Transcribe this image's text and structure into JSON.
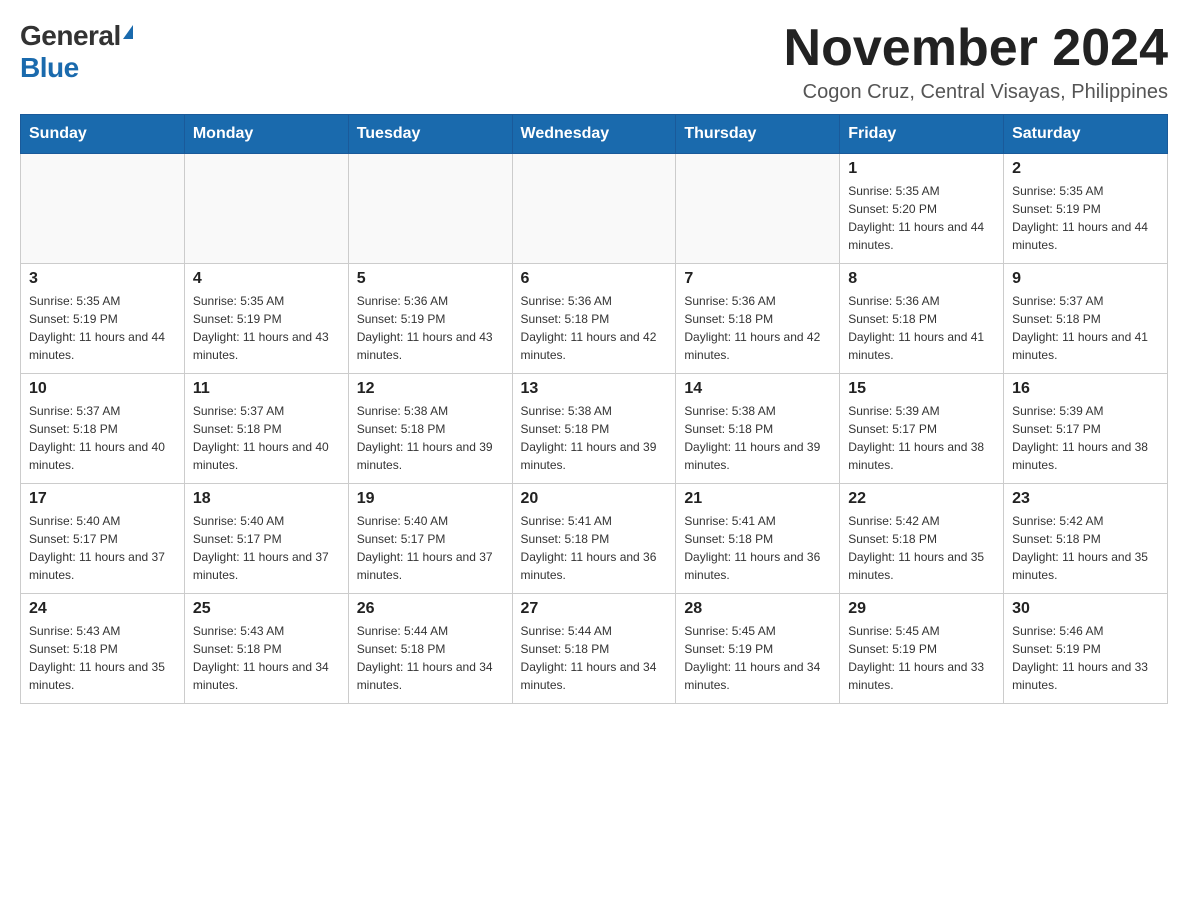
{
  "header": {
    "logo_general": "General",
    "logo_blue": "Blue",
    "month_title": "November 2024",
    "location": "Cogon Cruz, Central Visayas, Philippines"
  },
  "weekdays": [
    "Sunday",
    "Monday",
    "Tuesday",
    "Wednesday",
    "Thursday",
    "Friday",
    "Saturday"
  ],
  "weeks": [
    [
      {
        "day": "",
        "sunrise": "",
        "sunset": "",
        "daylight": ""
      },
      {
        "day": "",
        "sunrise": "",
        "sunset": "",
        "daylight": ""
      },
      {
        "day": "",
        "sunrise": "",
        "sunset": "",
        "daylight": ""
      },
      {
        "day": "",
        "sunrise": "",
        "sunset": "",
        "daylight": ""
      },
      {
        "day": "",
        "sunrise": "",
        "sunset": "",
        "daylight": ""
      },
      {
        "day": "1",
        "sunrise": "Sunrise: 5:35 AM",
        "sunset": "Sunset: 5:20 PM",
        "daylight": "Daylight: 11 hours and 44 minutes."
      },
      {
        "day": "2",
        "sunrise": "Sunrise: 5:35 AM",
        "sunset": "Sunset: 5:19 PM",
        "daylight": "Daylight: 11 hours and 44 minutes."
      }
    ],
    [
      {
        "day": "3",
        "sunrise": "Sunrise: 5:35 AM",
        "sunset": "Sunset: 5:19 PM",
        "daylight": "Daylight: 11 hours and 44 minutes."
      },
      {
        "day": "4",
        "sunrise": "Sunrise: 5:35 AM",
        "sunset": "Sunset: 5:19 PM",
        "daylight": "Daylight: 11 hours and 43 minutes."
      },
      {
        "day": "5",
        "sunrise": "Sunrise: 5:36 AM",
        "sunset": "Sunset: 5:19 PM",
        "daylight": "Daylight: 11 hours and 43 minutes."
      },
      {
        "day": "6",
        "sunrise": "Sunrise: 5:36 AM",
        "sunset": "Sunset: 5:18 PM",
        "daylight": "Daylight: 11 hours and 42 minutes."
      },
      {
        "day": "7",
        "sunrise": "Sunrise: 5:36 AM",
        "sunset": "Sunset: 5:18 PM",
        "daylight": "Daylight: 11 hours and 42 minutes."
      },
      {
        "day": "8",
        "sunrise": "Sunrise: 5:36 AM",
        "sunset": "Sunset: 5:18 PM",
        "daylight": "Daylight: 11 hours and 41 minutes."
      },
      {
        "day": "9",
        "sunrise": "Sunrise: 5:37 AM",
        "sunset": "Sunset: 5:18 PM",
        "daylight": "Daylight: 11 hours and 41 minutes."
      }
    ],
    [
      {
        "day": "10",
        "sunrise": "Sunrise: 5:37 AM",
        "sunset": "Sunset: 5:18 PM",
        "daylight": "Daylight: 11 hours and 40 minutes."
      },
      {
        "day": "11",
        "sunrise": "Sunrise: 5:37 AM",
        "sunset": "Sunset: 5:18 PM",
        "daylight": "Daylight: 11 hours and 40 minutes."
      },
      {
        "day": "12",
        "sunrise": "Sunrise: 5:38 AM",
        "sunset": "Sunset: 5:18 PM",
        "daylight": "Daylight: 11 hours and 39 minutes."
      },
      {
        "day": "13",
        "sunrise": "Sunrise: 5:38 AM",
        "sunset": "Sunset: 5:18 PM",
        "daylight": "Daylight: 11 hours and 39 minutes."
      },
      {
        "day": "14",
        "sunrise": "Sunrise: 5:38 AM",
        "sunset": "Sunset: 5:18 PM",
        "daylight": "Daylight: 11 hours and 39 minutes."
      },
      {
        "day": "15",
        "sunrise": "Sunrise: 5:39 AM",
        "sunset": "Sunset: 5:17 PM",
        "daylight": "Daylight: 11 hours and 38 minutes."
      },
      {
        "day": "16",
        "sunrise": "Sunrise: 5:39 AM",
        "sunset": "Sunset: 5:17 PM",
        "daylight": "Daylight: 11 hours and 38 minutes."
      }
    ],
    [
      {
        "day": "17",
        "sunrise": "Sunrise: 5:40 AM",
        "sunset": "Sunset: 5:17 PM",
        "daylight": "Daylight: 11 hours and 37 minutes."
      },
      {
        "day": "18",
        "sunrise": "Sunrise: 5:40 AM",
        "sunset": "Sunset: 5:17 PM",
        "daylight": "Daylight: 11 hours and 37 minutes."
      },
      {
        "day": "19",
        "sunrise": "Sunrise: 5:40 AM",
        "sunset": "Sunset: 5:17 PM",
        "daylight": "Daylight: 11 hours and 37 minutes."
      },
      {
        "day": "20",
        "sunrise": "Sunrise: 5:41 AM",
        "sunset": "Sunset: 5:18 PM",
        "daylight": "Daylight: 11 hours and 36 minutes."
      },
      {
        "day": "21",
        "sunrise": "Sunrise: 5:41 AM",
        "sunset": "Sunset: 5:18 PM",
        "daylight": "Daylight: 11 hours and 36 minutes."
      },
      {
        "day": "22",
        "sunrise": "Sunrise: 5:42 AM",
        "sunset": "Sunset: 5:18 PM",
        "daylight": "Daylight: 11 hours and 35 minutes."
      },
      {
        "day": "23",
        "sunrise": "Sunrise: 5:42 AM",
        "sunset": "Sunset: 5:18 PM",
        "daylight": "Daylight: 11 hours and 35 minutes."
      }
    ],
    [
      {
        "day": "24",
        "sunrise": "Sunrise: 5:43 AM",
        "sunset": "Sunset: 5:18 PM",
        "daylight": "Daylight: 11 hours and 35 minutes."
      },
      {
        "day": "25",
        "sunrise": "Sunrise: 5:43 AM",
        "sunset": "Sunset: 5:18 PM",
        "daylight": "Daylight: 11 hours and 34 minutes."
      },
      {
        "day": "26",
        "sunrise": "Sunrise: 5:44 AM",
        "sunset": "Sunset: 5:18 PM",
        "daylight": "Daylight: 11 hours and 34 minutes."
      },
      {
        "day": "27",
        "sunrise": "Sunrise: 5:44 AM",
        "sunset": "Sunset: 5:18 PM",
        "daylight": "Daylight: 11 hours and 34 minutes."
      },
      {
        "day": "28",
        "sunrise": "Sunrise: 5:45 AM",
        "sunset": "Sunset: 5:19 PM",
        "daylight": "Daylight: 11 hours and 34 minutes."
      },
      {
        "day": "29",
        "sunrise": "Sunrise: 5:45 AM",
        "sunset": "Sunset: 5:19 PM",
        "daylight": "Daylight: 11 hours and 33 minutes."
      },
      {
        "day": "30",
        "sunrise": "Sunrise: 5:46 AM",
        "sunset": "Sunset: 5:19 PM",
        "daylight": "Daylight: 11 hours and 33 minutes."
      }
    ]
  ]
}
